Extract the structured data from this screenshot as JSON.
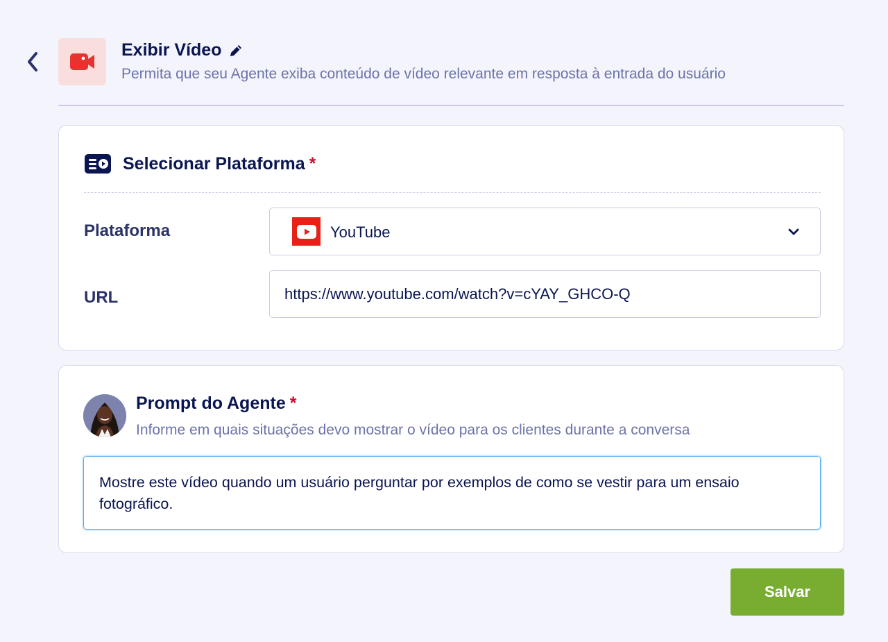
{
  "header": {
    "title": "Exibir Vídeo",
    "subtitle": "Permita que seu Agente exiba conteúdo de vídeo relevante em resposta à entrada do usuário",
    "icon": "video-camera-icon",
    "accent_color": "#e8322d"
  },
  "platform_section": {
    "title": "Selecionar Plataforma",
    "required_mark": "*",
    "icon": "video-list-icon",
    "platform_label": "Plataforma",
    "platform_value": "YouTube",
    "platform_icon": "youtube-icon",
    "url_label": "URL",
    "url_value": "https://www.youtube.com/watch?v=cYAY_GHCO-Q"
  },
  "prompt_section": {
    "title": "Prompt do Agente",
    "required_mark": "*",
    "subtitle": "Informe em quais situações devo mostrar o vídeo para os clientes durante a conversa",
    "prompt_value": "Mostre este vídeo quando um usuário perguntar por exemplos de como se vestir para um ensaio fotográfico."
  },
  "actions": {
    "save_label": "Salvar",
    "save_color": "#78ad32"
  }
}
